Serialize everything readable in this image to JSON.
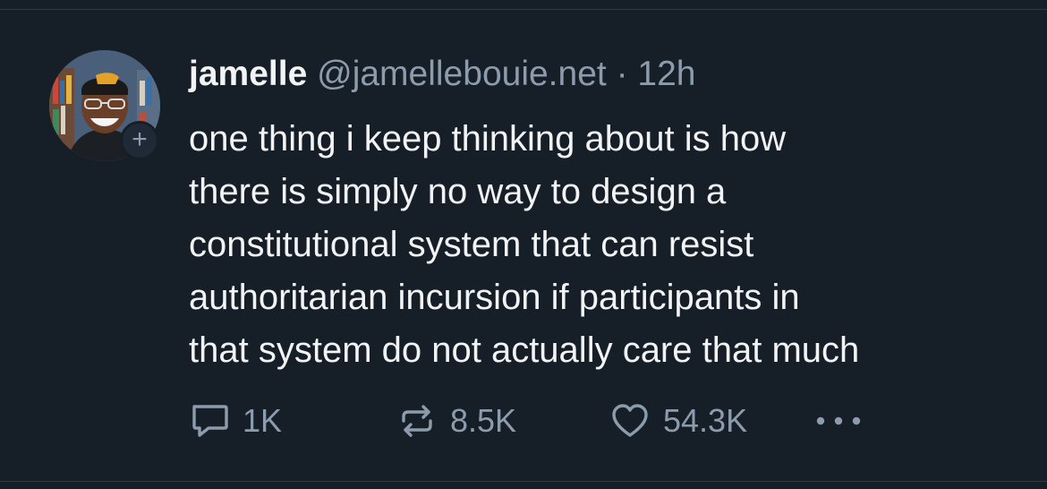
{
  "post": {
    "author": {
      "display_name": "jamelle",
      "handle": "@jamellebouie.net",
      "avatar_icon": "profile-photo",
      "follow_icon": "plus-icon",
      "follow_symbol": "+"
    },
    "separator": "·",
    "time": "12h",
    "text_lines": [
      "one thing i keep thinking about is how",
      "there is simply no way to design a",
      "constitutional system that can resist",
      "authoritarian incursion if participants in",
      "that system do not actually care that much"
    ],
    "actions": {
      "reply": {
        "icon": "reply-icon",
        "count": "1K"
      },
      "repost": {
        "icon": "repost-icon",
        "count": "8.5K"
      },
      "like": {
        "icon": "heart-icon",
        "count": "54.3K"
      },
      "more": {
        "icon": "more-icon"
      }
    }
  },
  "colors": {
    "background": "#161e27",
    "text_primary": "#f1f3f5",
    "text_secondary": "#8d9cad",
    "divider": "#2e3945"
  }
}
